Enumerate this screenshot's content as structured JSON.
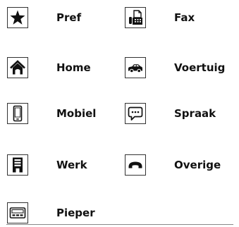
{
  "items": [
    {
      "label": "Pref",
      "icon": "star-icon"
    },
    {
      "label": "Fax",
      "icon": "fax-icon"
    },
    {
      "label": "Home",
      "icon": "home-icon"
    },
    {
      "label": "Voertuig",
      "icon": "car-icon"
    },
    {
      "label": "Mobiel",
      "icon": "mobile-phone-icon"
    },
    {
      "label": "Spraak",
      "icon": "speech-bubble-icon"
    },
    {
      "label": "Werk",
      "icon": "office-building-icon"
    },
    {
      "label": "Overige",
      "icon": "phone-handset-icon"
    },
    {
      "label": "Pieper",
      "icon": "pager-icon"
    }
  ],
  "colors": {
    "icon_stroke": "#111111",
    "text": "#111111"
  }
}
